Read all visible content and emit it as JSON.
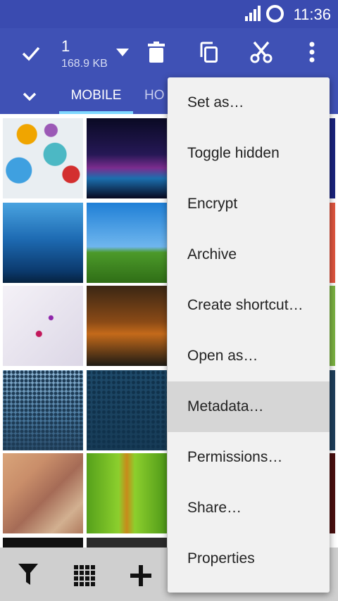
{
  "status_bar": {
    "time": "11:36",
    "signal_icon": "cell-signal-icon",
    "sync_icon": "sync-ring-icon"
  },
  "action_bar": {
    "selected_count": "1",
    "selected_size": "168.9 KB",
    "icons": [
      "check-icon",
      "dropdown-arrow-icon",
      "trash-icon",
      "copy-icon",
      "cut-icon",
      "more-vert-icon"
    ]
  },
  "tabs": [
    {
      "label": "MOBILE",
      "active": true
    },
    {
      "label": "HO"
    }
  ],
  "menu": {
    "items": [
      "Set as…",
      "Toggle hidden",
      "Encrypt",
      "Archive",
      "Create shortcut…",
      "Open as…",
      "Metadata…",
      "Permissions…",
      "Share…",
      "Properties"
    ],
    "highlighted": "Metadata…"
  },
  "bottom_bar": {
    "icons": [
      "filter-icon",
      "grid-view-icon",
      "add-icon"
    ]
  },
  "colors": {
    "primary": "#3f51b5",
    "status_bar": "#3a4bb0",
    "tab_indicator": "#7fd8ff",
    "menu_bg": "#f1f1f1",
    "menu_highlight": "#d6d6d6"
  }
}
